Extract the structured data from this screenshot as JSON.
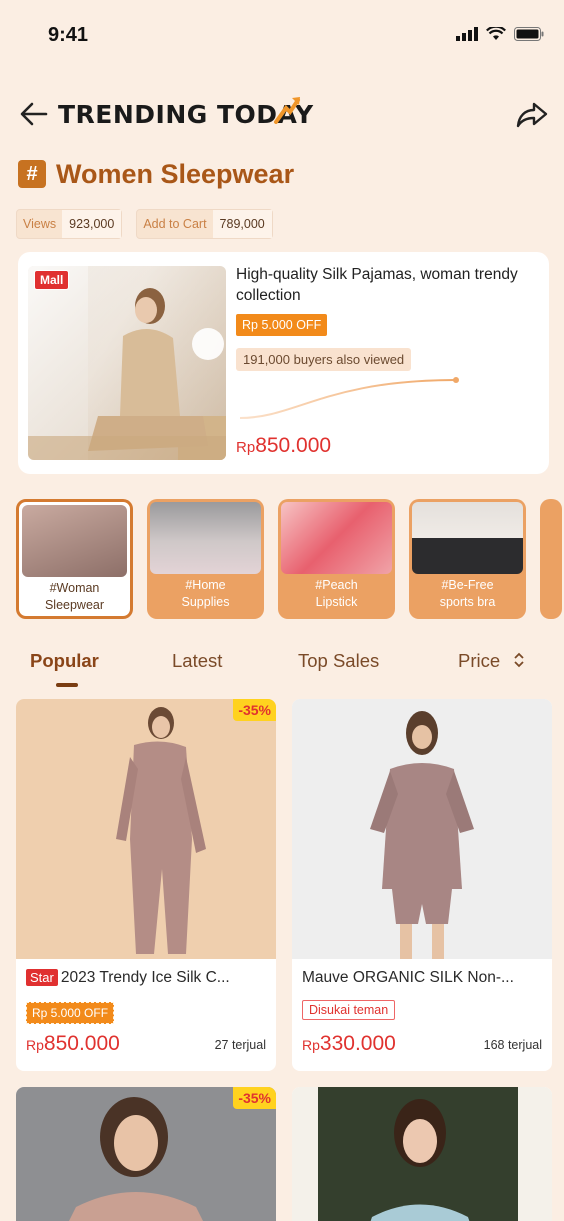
{
  "status_bar": {
    "time": "9:41"
  },
  "header": {
    "title": "TRENDING TODAY"
  },
  "category": {
    "title": "Women Sleepwear",
    "stats": [
      {
        "label": "Views",
        "value": "923,000"
      },
      {
        "label": "Add to Cart",
        "value": "789,000"
      }
    ]
  },
  "hero": {
    "badge": "Mall",
    "name": "High-quality Silk Pajamas, woman trendy collection",
    "discount": "Rp 5.000 OFF",
    "viewed": "191,000 buyers also viewed",
    "price_currency": "Rp",
    "price": "850.000"
  },
  "categories": [
    {
      "label": "#Woman Sleepwear",
      "active": true
    },
    {
      "label": "#Home Supplies",
      "active": false
    },
    {
      "label": "#Peach Lipstick",
      "active": false
    },
    {
      "label": "#Be-Free sports bra",
      "active": false
    }
  ],
  "tabs": [
    "Popular",
    "Latest",
    "Top Sales",
    "Price"
  ],
  "products": [
    {
      "discount": "-35%",
      "badge": "Star",
      "title": "2023 Trendy Ice Silk C...",
      "off": "Rp 5.000 OFF",
      "currency": "Rp",
      "price": "850.000",
      "sold": "27 terjual"
    },
    {
      "title": "Mauve ORGANIC SILK Non-...",
      "tag": "Disukai teman",
      "currency": "Rp",
      "price": "330.000",
      "sold": "168 terjual"
    },
    {
      "discount": "-35%"
    },
    {}
  ],
  "colors": {
    "accent": "#a95718",
    "price": "#e0322f",
    "background": "#fbeee3"
  }
}
